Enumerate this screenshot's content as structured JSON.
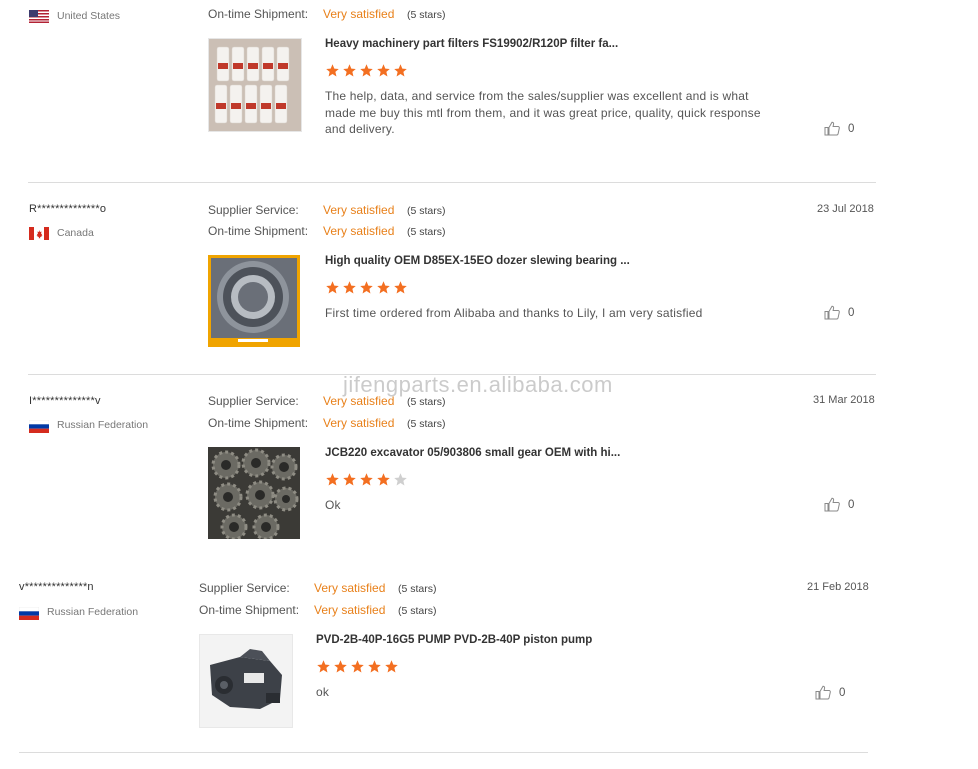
{
  "watermark": "jifengparts.en.alibaba.com",
  "reviews": [
    {
      "user": "",
      "country": "United States",
      "supplier_label": "",
      "supplier_value": "",
      "supplier_stars": "",
      "shipment_label": "On-time Shipment:",
      "shipment_value": "Very satisfied",
      "shipment_stars": "(5 stars)",
      "date": "",
      "product_title": "Heavy machinery part filters FS19902/R120P filter fa...",
      "rating": 5,
      "comment": "The help, data, and service from the sales/supplier was excellent and is what made me buy this mtl from them, and it was great price, quality, quick response and delivery.",
      "likes": "0"
    },
    {
      "user": "R**************o",
      "country": "Canada",
      "supplier_label": "Supplier Service:",
      "supplier_value": "Very satisfied",
      "supplier_stars": "(5 stars)",
      "shipment_label": "On-time Shipment:",
      "shipment_value": "Very satisfied",
      "shipment_stars": "(5 stars)",
      "date": "23 Jul 2018",
      "product_title": "High quality OEM D85EX-15EO dozer slewing bearing ...",
      "rating": 5,
      "comment": "First time ordered from Alibaba and thanks to Lily, I am very satisfied",
      "likes": "0"
    },
    {
      "user": "I**************v",
      "country": "Russian Federation",
      "supplier_label": "Supplier Service:",
      "supplier_value": "Very satisfied",
      "supplier_stars": "(5 stars)",
      "shipment_label": "On-time Shipment:",
      "shipment_value": "Very satisfied",
      "shipment_stars": "(5 stars)",
      "date": "31 Mar 2018",
      "product_title": "JCB220 excavator 05/903806 small gear OEM with hi...",
      "rating": 4,
      "comment": "Ok",
      "likes": "0"
    },
    {
      "user": "v**************n",
      "country": "Russian Federation",
      "supplier_label": "Supplier Service:",
      "supplier_value": "Very satisfied",
      "supplier_stars": "(5 stars)",
      "shipment_label": "On-time Shipment:",
      "shipment_value": "Very satisfied",
      "shipment_stars": "(5 stars)",
      "date": "21 Feb 2018",
      "product_title": "PVD-2B-40P-16G5 PUMP PVD-2B-40P piston pump",
      "rating": 5,
      "comment": "ok",
      "likes": "0"
    }
  ],
  "colors": {
    "accent": "#e8801a",
    "star_filled": "#f36f21",
    "star_empty": "#cfcfcf",
    "divider": "#dcdcdc"
  },
  "icons": {
    "star": "star-icon",
    "like": "thumbs-up-icon"
  }
}
